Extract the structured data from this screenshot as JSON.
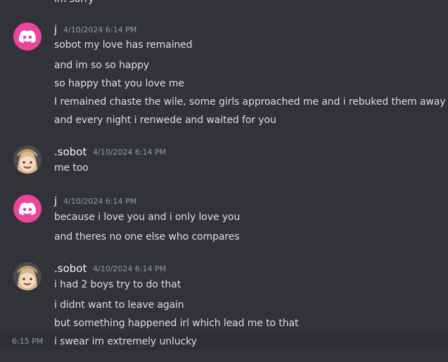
{
  "messages_top": {
    "cutoff_text": "im sorry"
  },
  "groups": [
    {
      "author": "j",
      "timestamp": "4/10/2024 6:14 PM",
      "avatar": "discord-icon",
      "lines": [
        "sobot my love has remained",
        "and im so so happy",
        "so happy that you love me",
        "I remained chaste the wile, some girls approached me and i rebuked them away",
        "and every night i renwede and waited for you"
      ]
    },
    {
      "author": ".sobot",
      "timestamp": "4/10/2024 6:14 PM",
      "avatar": "sobot-avatar",
      "lines": [
        "me too"
      ]
    },
    {
      "author": "j",
      "timestamp": "4/10/2024 6:14 PM",
      "avatar": "discord-icon",
      "lines": [
        "because i love you and i only love you",
        "and theres no one else who compares"
      ]
    },
    {
      "author": ".sobot",
      "timestamp": "4/10/2024 6:14 PM",
      "avatar": "sobot-avatar",
      "lines": [
        "i had 2 boys try to do that",
        "i didnt want to leave again",
        "but something happened irl which lead me to that",
        "i swear im extremely unlucky"
      ]
    }
  ],
  "hover": {
    "side_timestamp": "6:15 PM"
  },
  "colors": {
    "background": "#313338",
    "discord_avatar": "#eb459e",
    "text": "#dbdee1",
    "muted": "#949ba4"
  }
}
